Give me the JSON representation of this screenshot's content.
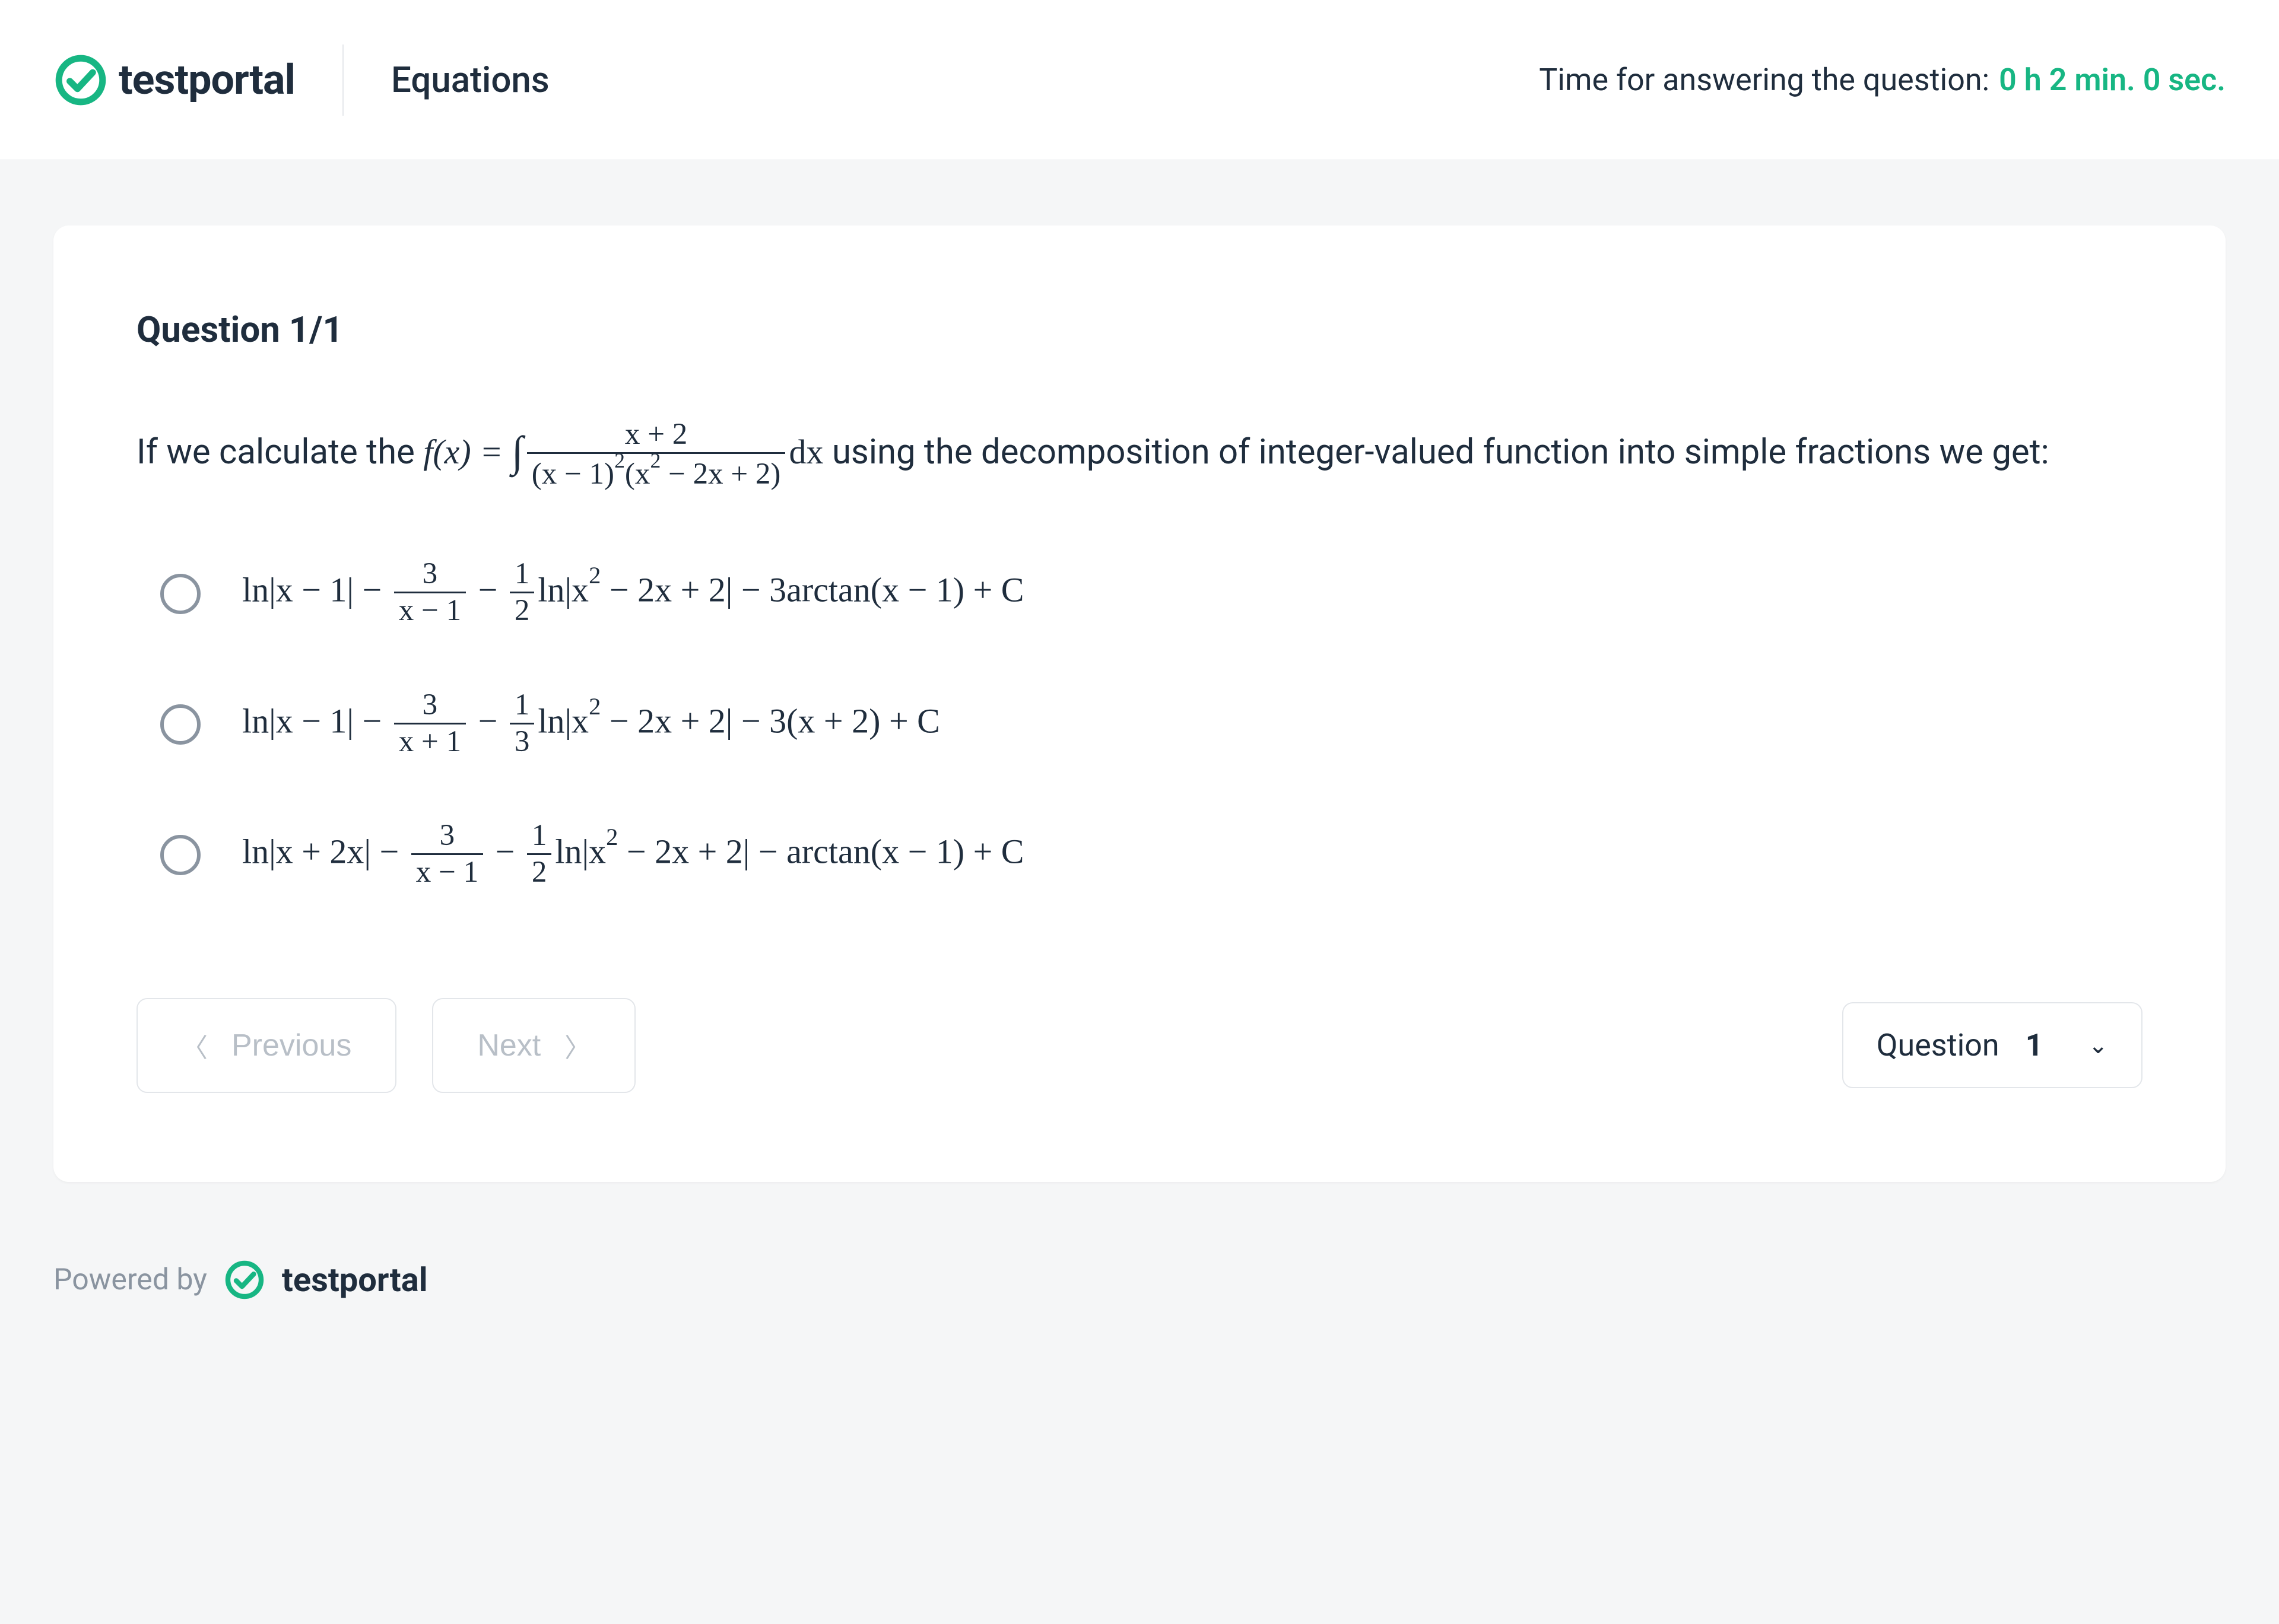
{
  "header": {
    "brand": "testportal",
    "title": "Equations",
    "timer_label": "Time for answering the question:",
    "timer_value": "0 h 2 min. 0 sec."
  },
  "question": {
    "counter": "Question 1/1",
    "text_before": "If we calculate the ",
    "text_after": " using the decomposition of integer-valued function into simple fractions we get:",
    "formula": {
      "lhs": "f(x) =",
      "integrand_num": "x + 2",
      "integrand_den_a": "(x − 1)",
      "integrand_den_exp1": "2",
      "integrand_den_b": "(x",
      "integrand_den_exp2": "2",
      "integrand_den_c": " − 2x + 2)",
      "dx": "dx"
    }
  },
  "answers": [
    {
      "p1": "ln|x − 1| − ",
      "f1n": "3",
      "f1d": "x − 1",
      "p2": " − ",
      "f2n": "1",
      "f2d": "2",
      "p3": "ln|x",
      "supA": "2",
      "p3b": " − 2x + 2| − 3arctan(x − 1) + C"
    },
    {
      "p1": "ln|x − 1| − ",
      "f1n": "3",
      "f1d": "x + 1",
      "p2": " − ",
      "f2n": "1",
      "f2d": "3",
      "p3": "ln|x",
      "supA": "2",
      "p3b": " − 2x + 2| − 3(x + 2) + C"
    },
    {
      "p1": "ln|x + 2x| − ",
      "f1n": "3",
      "f1d": "x − 1",
      "p2": " − ",
      "f2n": "1",
      "f2d": "2",
      "p3": "ln|x",
      "supA": "2",
      "p3b": " − 2x + 2| − arctan(x − 1) + C"
    }
  ],
  "nav": {
    "prev": "Previous",
    "next": "Next",
    "select_label": "Question",
    "select_value": "1"
  },
  "footer": {
    "powered_by": "Powered by",
    "brand": "testportal"
  },
  "colors": {
    "accent": "#17b683"
  }
}
